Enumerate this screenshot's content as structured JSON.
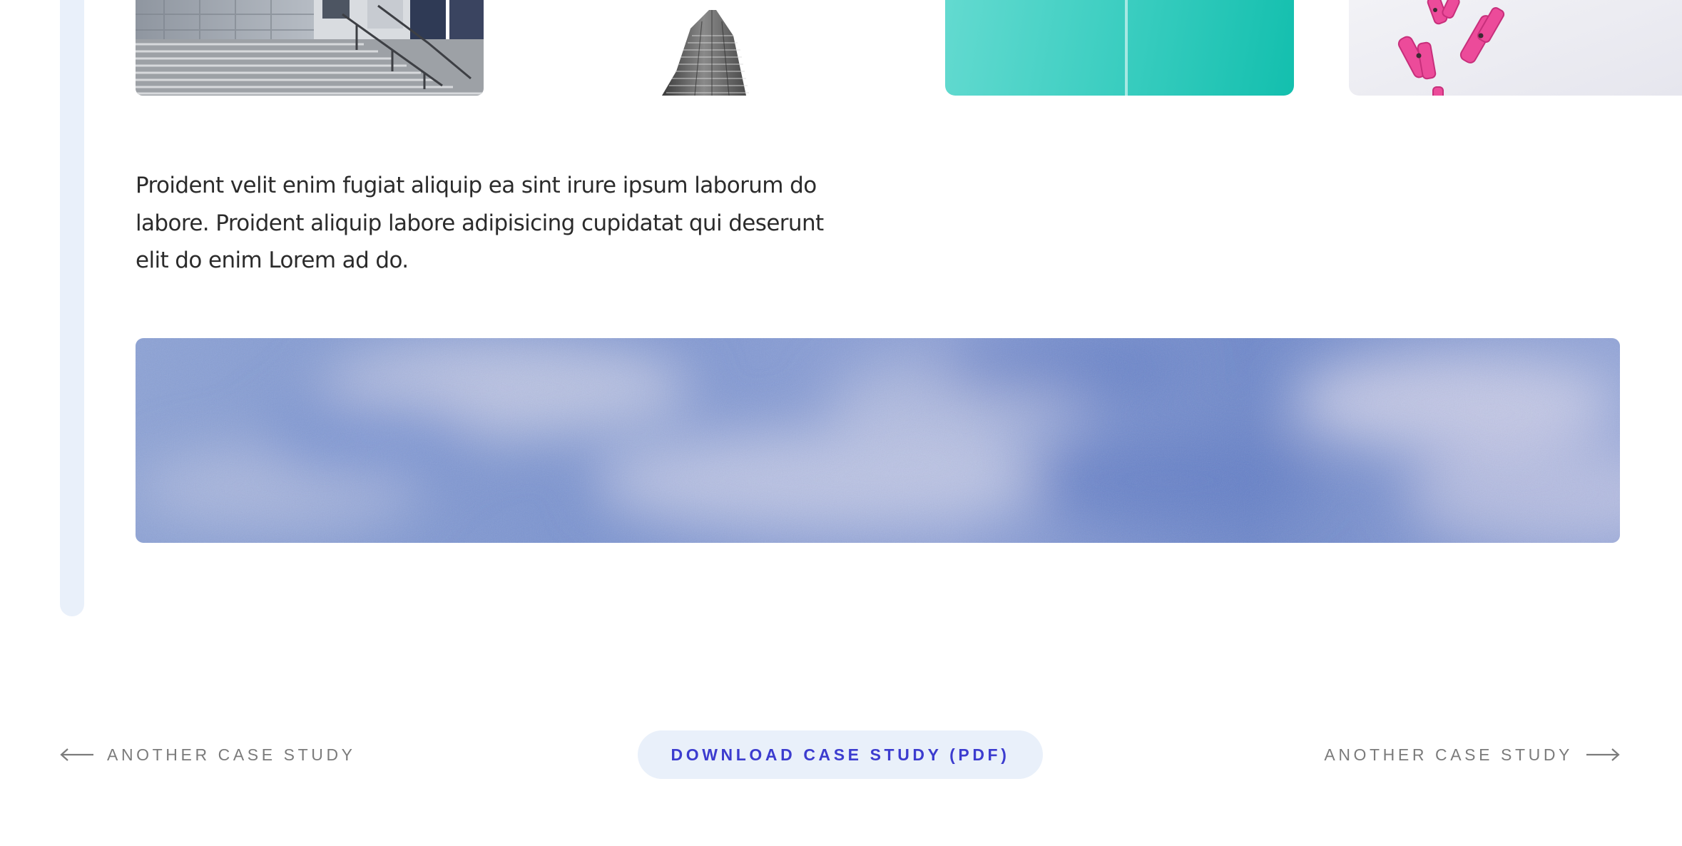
{
  "thumbnails": [
    {
      "icon": "building-steps-photo"
    },
    {
      "icon": "skyscraper-photo"
    },
    {
      "icon": "teal-surface-photo"
    },
    {
      "icon": "pink-clothespins-photo"
    }
  ],
  "content": {
    "paragraph": "Proident velit enim fugiat aliquip ea sint irure ipsum laborum do labore. Proident aliquip labore adipisicing cupidatat qui deserunt elit do enim Lorem ad do."
  },
  "banner": {
    "icon": "blue-sky-photo"
  },
  "footer": {
    "prev_label": "ANOTHER CASE STUDY",
    "download_label": "DOWNLOAD CASE STUDY (PDF)",
    "next_label": "ANOTHER CASE STUDY"
  },
  "colors": {
    "accent_text": "#3c3ccf",
    "accent_bg": "#e9f0fa",
    "muted_text": "#7b7b7b",
    "body_text": "#2b2b2b"
  }
}
